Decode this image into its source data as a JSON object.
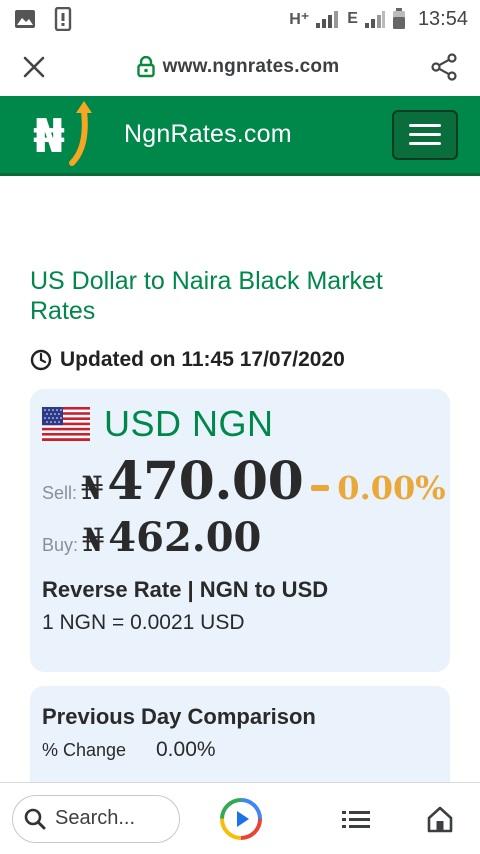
{
  "status_bar": {
    "network_1": "H⁺",
    "network_2": "E",
    "time": "13:54"
  },
  "browser": {
    "url": "www.ngnrates.com"
  },
  "site_header": {
    "name": "NgnRates.com",
    "logo_symbol": "₦"
  },
  "main": {
    "title": "US Dollar to Naira Black Market Rates",
    "updated": "Updated on 11:45 17/07/2020"
  },
  "rate_card": {
    "pair": "USD NGN",
    "sell_label": "Sell:",
    "sell_currency": "₦",
    "sell_value": "470.00",
    "change": "0.00%",
    "buy_label": "Buy:",
    "buy_currency": "₦",
    "buy_value": "462.00",
    "reverse_title": "Reverse Rate | NGN to USD",
    "reverse_value": "1 NGN = 0.0021 USD"
  },
  "previous_card": {
    "title": "Previous Day Comparison",
    "change_label": "% Change",
    "change_value": "0.00%"
  },
  "bottom_bar": {
    "search_placeholder": "Search..."
  },
  "colors": {
    "brand_green": "#00874a",
    "change_orange": "#eba83a",
    "card_bg": "#eaf3fc"
  },
  "icons": [
    "gallery-icon",
    "sim-icon",
    "signal-icon",
    "battery-icon",
    "close-icon",
    "lock-icon",
    "share-icon",
    "naira-logo-icon",
    "hamburger-menu-icon",
    "clock-icon",
    "us-flag-icon",
    "search-icon",
    "assistant-icon",
    "list-icon",
    "home-icon"
  ]
}
